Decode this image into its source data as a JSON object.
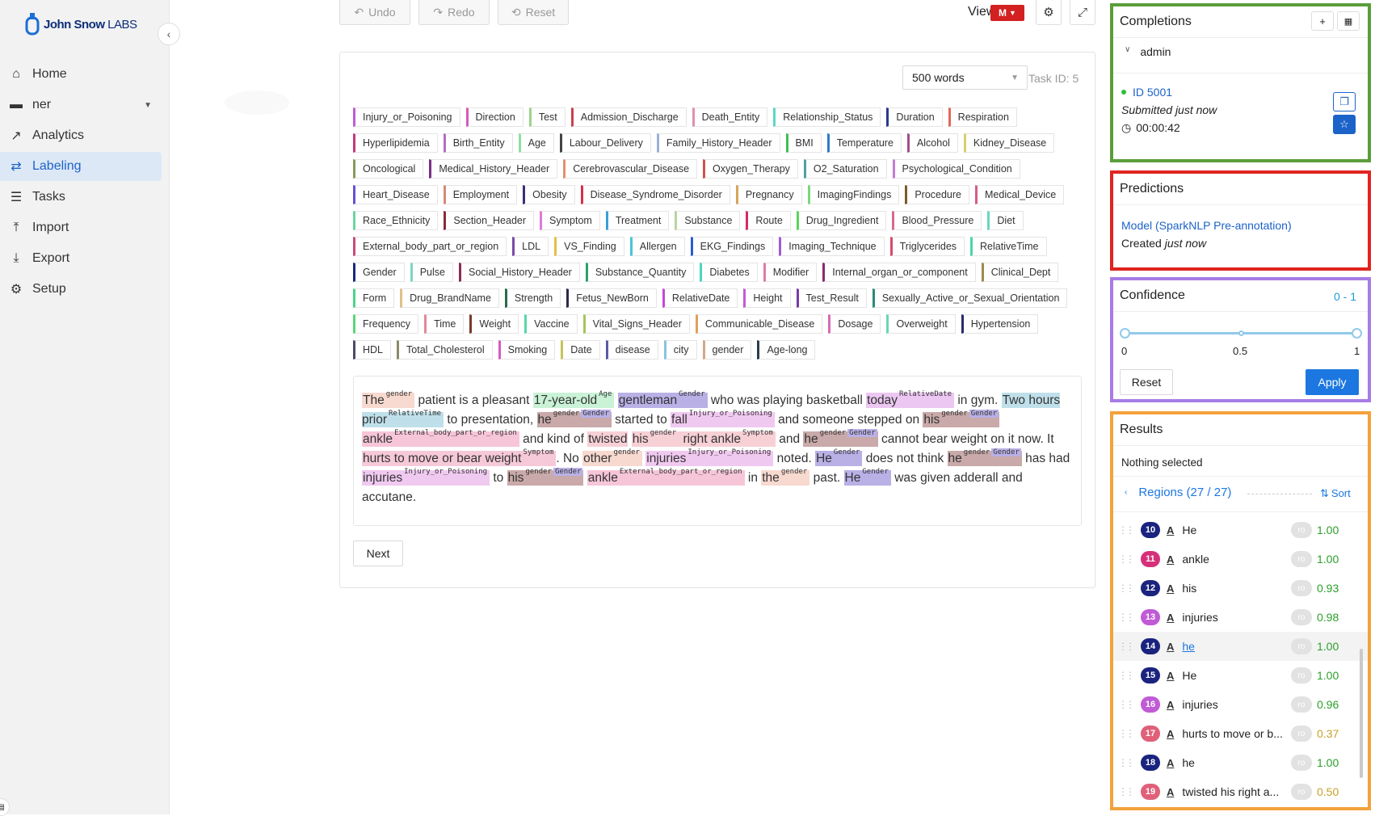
{
  "sidebar": {
    "logo": {
      "brand": "John Snow",
      "suffix": "LABS"
    },
    "items": [
      {
        "label": "Home",
        "icon": "home-icon"
      },
      {
        "label": "ner",
        "icon": "folder-icon"
      },
      {
        "label": "Analytics",
        "icon": "chart-icon"
      },
      {
        "label": "Labeling",
        "icon": "swap-icon"
      },
      {
        "label": "Tasks",
        "icon": "list-icon"
      },
      {
        "label": "Import",
        "icon": "upload-icon"
      },
      {
        "label": "Export",
        "icon": "download-icon"
      },
      {
        "label": "Setup",
        "icon": "gears-icon"
      }
    ]
  },
  "toolbar": {
    "undo": "Undo",
    "redo": "Redo",
    "reset": "Reset",
    "view_as": "View as",
    "view_badge": "M"
  },
  "main": {
    "words_select": "500 words",
    "task_id": "Task ID: 5",
    "labels": [
      {
        "name": "Injury_or_Poisoning",
        "color": "#c05bd6"
      },
      {
        "name": "Direction",
        "color": "#d65bb9"
      },
      {
        "name": "Test",
        "color": "#9ed48a"
      },
      {
        "name": "Admission_Discharge",
        "color": "#c9414d"
      },
      {
        "name": "Death_Entity",
        "color": "#e08fb3"
      },
      {
        "name": "Relationship_Status",
        "color": "#5ed6c9"
      },
      {
        "name": "Duration",
        "color": "#2a3a8c"
      },
      {
        "name": "Respiration",
        "color": "#e06a5b"
      },
      {
        "name": "Hyperlipidemia",
        "color": "#c4397b"
      },
      {
        "name": "Birth_Entity",
        "color": "#b46ec9"
      },
      {
        "name": "Age",
        "color": "#8ee0a3"
      },
      {
        "name": "Labour_Delivery",
        "color": "#444444"
      },
      {
        "name": "Family_History_Header",
        "color": "#9bb0d6"
      },
      {
        "name": "BMI",
        "color": "#3fbf4f"
      },
      {
        "name": "Temperature",
        "color": "#2d7cc9"
      },
      {
        "name": "Alcohol",
        "color": "#a34d8c"
      },
      {
        "name": "Kidney_Disease",
        "color": "#d6d06a"
      },
      {
        "name": "Oncological",
        "color": "#8a9a5b"
      },
      {
        "name": "Medical_History_Header",
        "color": "#7a2e86"
      },
      {
        "name": "Cerebrovascular_Disease",
        "color": "#e68f6b"
      },
      {
        "name": "Oxygen_Therapy",
        "color": "#d14f4f"
      },
      {
        "name": "O2_Saturation",
        "color": "#4f9fa8"
      },
      {
        "name": "Psychological_Condition",
        "color": "#c77ad6"
      },
      {
        "name": "Heart_Disease",
        "color": "#6a4fd6"
      },
      {
        "name": "Employment",
        "color": "#d6887a"
      },
      {
        "name": "Obesity",
        "color": "#3a2f7a"
      },
      {
        "name": "Disease_Syndrome_Disorder",
        "color": "#d6304a"
      },
      {
        "name": "Pregnancy",
        "color": "#d6a55b"
      },
      {
        "name": "ImagingFindings",
        "color": "#7cd67a"
      },
      {
        "name": "Procedure",
        "color": "#7a5a2a"
      },
      {
        "name": "Medical_Device",
        "color": "#d65b8a"
      },
      {
        "name": "Race_Ethnicity",
        "color": "#6ad69f"
      },
      {
        "name": "Section_Header",
        "color": "#8a2a3a"
      },
      {
        "name": "Symptom",
        "color": "#e07ad6"
      },
      {
        "name": "Treatment",
        "color": "#3aa0d6"
      },
      {
        "name": "Substance",
        "color": "#b6d6a0"
      },
      {
        "name": "Route",
        "color": "#d62a6a"
      },
      {
        "name": "Drug_Ingredient",
        "color": "#5ad65a"
      },
      {
        "name": "Blood_Pressure",
        "color": "#d66a8a"
      },
      {
        "name": "Diet",
        "color": "#6ad6c0"
      },
      {
        "name": "External_body_part_or_region",
        "color": "#c94a7a"
      },
      {
        "name": "LDL",
        "color": "#7a4aa6"
      },
      {
        "name": "VS_Finding",
        "color": "#e0c04a"
      },
      {
        "name": "Allergen",
        "color": "#4ac4d6"
      },
      {
        "name": "EKG_Findings",
        "color": "#2a5ad6"
      },
      {
        "name": "Imaging_Technique",
        "color": "#a05ad6"
      },
      {
        "name": "Triglycerides",
        "color": "#d64a6a"
      },
      {
        "name": "RelativeTime",
        "color": "#4ad6a6"
      },
      {
        "name": "Gender",
        "color": "#1a2a7a"
      },
      {
        "name": "Pulse",
        "color": "#7ad6c4"
      },
      {
        "name": "Social_History_Header",
        "color": "#8a2a5a"
      },
      {
        "name": "Substance_Quantity",
        "color": "#2aa06a"
      },
      {
        "name": "Diabetes",
        "color": "#4ad6c4"
      },
      {
        "name": "Modifier",
        "color": "#e07aa6"
      },
      {
        "name": "Internal_organ_or_component",
        "color": "#8a2a6a"
      },
      {
        "name": "Clinical_Dept",
        "color": "#a08a4a"
      },
      {
        "name": "Form",
        "color": "#4ad68a"
      },
      {
        "name": "Drug_BrandName",
        "color": "#e0c08a"
      },
      {
        "name": "Strength",
        "color": "#2a6a4a"
      },
      {
        "name": "Fetus_NewBorn",
        "color": "#2a2a4a"
      },
      {
        "name": "RelativeDate",
        "color": "#c44ad6"
      },
      {
        "name": "Height",
        "color": "#c45ad6"
      },
      {
        "name": "Test_Result",
        "color": "#7a3aa6"
      },
      {
        "name": "Sexually_Active_or_Sexual_Orientation",
        "color": "#2a8a7a"
      },
      {
        "name": "Frequency",
        "color": "#5ad67a"
      },
      {
        "name": "Time",
        "color": "#e08a9a"
      },
      {
        "name": "Weight",
        "color": "#7a3a2a"
      },
      {
        "name": "Vaccine",
        "color": "#5ad6a6"
      },
      {
        "name": "Vital_Signs_Header",
        "color": "#a6c45a"
      },
      {
        "name": "Communicable_Disease",
        "color": "#e0a05a"
      },
      {
        "name": "Dosage",
        "color": "#d66ab6"
      },
      {
        "name": "Overweight",
        "color": "#6ad6b0"
      },
      {
        "name": "Hypertension",
        "color": "#2a2a6a"
      },
      {
        "name": "HDL",
        "color": "#4a4a6a"
      },
      {
        "name": "Total_Cholesterol",
        "color": "#8a8a6a"
      },
      {
        "name": "Smoking",
        "color": "#d65ac4"
      },
      {
        "name": "Date",
        "color": "#c4c45a"
      },
      {
        "name": "disease",
        "color": "#5a5aa6"
      },
      {
        "name": "city",
        "color": "#8ac4e0"
      },
      {
        "name": "gender",
        "color": "#d6a58a"
      },
      {
        "name": "Age-long",
        "color": "#2a3a4a"
      }
    ],
    "text_segments": [
      {
        "t": "The",
        "bg": "#f7d9cf",
        "tag": "gender"
      },
      {
        "t": " patient is a pleasant "
      },
      {
        "t": "17-year-old",
        "bg": "#c9f2d6",
        "tag": "Age"
      },
      {
        "t": " "
      },
      {
        "t": "gentleman",
        "bg": "#b9b0e6",
        "tag": "Gender"
      },
      {
        "t": " who was playing basketball "
      },
      {
        "t": "today",
        "bg": "#ecc7f2",
        "tag": "RelativeDate"
      },
      {
        "t": " in gym. "
      },
      {
        "t": "Two hours prior",
        "bg": "#bfe0ea",
        "tag": "RelativeTime"
      },
      {
        "t": " to presentation, "
      },
      {
        "t": "he",
        "bg": "#c9a9a9",
        "tag": "gender",
        "tag2": "Gender"
      },
      {
        "t": " started to "
      },
      {
        "t": "fall",
        "bg": "#f0c9f0",
        "tag": "Injury_or_Poisoning"
      },
      {
        "t": " and someone stepped on "
      },
      {
        "t": "his",
        "bg": "#c9a9a9",
        "tag": "gender",
        "tag2": "Gender"
      },
      {
        "t": " "
      },
      {
        "t": "ankle",
        "bg": "#f6c5d8",
        "tag": "External_body_part_or_region"
      },
      {
        "t": " and kind of "
      },
      {
        "t": "twisted",
        "bg": "#f7d0d6"
      },
      {
        "t": " "
      },
      {
        "t": "his",
        "bg": "#f7d0d6",
        "tag": "gender"
      },
      {
        "t": " right ankle",
        "bg": "#f7d0d6",
        "tag": "Symptom"
      },
      {
        "t": " and "
      },
      {
        "t": "he",
        "bg": "#c9a9a9",
        "tag": "gender",
        "tag2": "Gender"
      },
      {
        "t": " cannot bear weight on it now. It "
      },
      {
        "t": "hurts to move or bear weight",
        "bg": "#f6c9d9",
        "tag": "Symptom"
      },
      {
        "t": ". No "
      },
      {
        "t": "other",
        "bg": "#f7d9cf",
        "tag": "gender"
      },
      {
        "t": " "
      },
      {
        "t": "injuries",
        "bg": "#f0c9f0",
        "tag": "Injury_or_Poisoning"
      },
      {
        "t": " noted. "
      },
      {
        "t": "He",
        "bg": "#b9b0e6",
        "tag": "Gender"
      },
      {
        "t": " does not think "
      },
      {
        "t": "he",
        "bg": "#c9a9a9",
        "tag": "gender",
        "tag2": "Gender"
      },
      {
        "t": " has had "
      },
      {
        "t": "injuries",
        "bg": "#f0c9f0",
        "tag": "Injury_or_Poisoning"
      },
      {
        "t": " to "
      },
      {
        "t": "his",
        "bg": "#c9a9a9",
        "tag": "gender",
        "tag2": "Gender"
      },
      {
        "t": " "
      },
      {
        "t": "ankle",
        "bg": "#f6c5d8",
        "tag": "External_body_part_or_region"
      },
      {
        "t": " in "
      },
      {
        "t": "the",
        "bg": "#f7d9cf",
        "tag": "gender"
      },
      {
        "t": " past. "
      },
      {
        "t": "He",
        "bg": "#b9b0e6",
        "tag": "Gender"
      },
      {
        "t": " was given adderall and accutane."
      }
    ],
    "next_label": "Next"
  },
  "completions": {
    "title": "Completions",
    "user": "admin",
    "id": "ID 5001",
    "submitted_prefix": "Submitted",
    "submitted_suffix": "just now",
    "duration": "00:00:42"
  },
  "predictions": {
    "title": "Predictions",
    "model": "Model (SparkNLP Pre-annotation)",
    "created_prefix": "Created",
    "created_suffix": "just now"
  },
  "confidence": {
    "title": "Confidence",
    "range_label": "0 - 1",
    "min": "0",
    "mid": "0.5",
    "max": "1",
    "low_value": 0,
    "high_value": 1,
    "reset": "Reset",
    "apply": "Apply"
  },
  "results": {
    "title": "Results",
    "nothing": "Nothing selected",
    "regions": "Regions (27 / 27)",
    "sort": "Sort",
    "rows": [
      {
        "n": "10",
        "text": "He",
        "score": "1.00",
        "color": "#1a237e",
        "sc": "#2aa02a"
      },
      {
        "n": "11",
        "text": "ankle",
        "score": "1.00",
        "color": "#d6307a",
        "sc": "#2aa02a"
      },
      {
        "n": "12",
        "text": "his",
        "score": "0.93",
        "color": "#1a237e",
        "sc": "#2aa02a"
      },
      {
        "n": "13",
        "text": "injuries",
        "score": "0.98",
        "color": "#c05bd6",
        "sc": "#2aa02a"
      },
      {
        "n": "14",
        "text": "he",
        "score": "1.00",
        "color": "#1a237e",
        "sc": "#2aa02a",
        "active": true
      },
      {
        "n": "15",
        "text": "He",
        "score": "1.00",
        "color": "#1a237e",
        "sc": "#2aa02a"
      },
      {
        "n": "16",
        "text": "injuries",
        "score": "0.96",
        "color": "#c05bd6",
        "sc": "#2aa02a"
      },
      {
        "n": "17",
        "text": "hurts to move or b...",
        "score": "0.37",
        "color": "#e0607a",
        "sc": "#c9a02a"
      },
      {
        "n": "18",
        "text": "he",
        "score": "1.00",
        "color": "#1a237e",
        "sc": "#2aa02a"
      },
      {
        "n": "19",
        "text": "twisted his right a...",
        "score": "0.50",
        "color": "#e0607a",
        "sc": "#c9a02a"
      }
    ],
    "ro": "ro"
  }
}
